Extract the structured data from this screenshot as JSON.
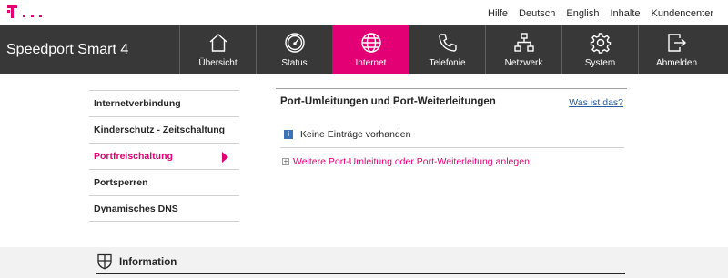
{
  "top_links": [
    "Hilfe",
    "Deutsch",
    "English",
    "Inhalte",
    "Kundencenter"
  ],
  "brand": "Speedport Smart 4",
  "nav": [
    {
      "label": "Übersicht",
      "icon": "home-icon",
      "active": false
    },
    {
      "label": "Status",
      "icon": "gauge-icon",
      "active": false
    },
    {
      "label": "Internet",
      "icon": "globe-icon",
      "active": true
    },
    {
      "label": "Telefonie",
      "icon": "phone-icon",
      "active": false
    },
    {
      "label": "Netzwerk",
      "icon": "network-icon",
      "active": false
    },
    {
      "label": "System",
      "icon": "gear-icon",
      "active": false
    },
    {
      "label": "Abmelden",
      "icon": "logout-icon",
      "active": false
    }
  ],
  "sidebar": [
    {
      "label": "Internetverbindung",
      "active": false
    },
    {
      "label": "Kinderschutz - Zeitschaltung",
      "active": false
    },
    {
      "label": "Portfreischaltung",
      "active": true
    },
    {
      "label": "Portsperren",
      "active": false
    },
    {
      "label": "Dynamisches DNS",
      "active": false
    }
  ],
  "panel": {
    "title": "Port-Umleitungen und Port-Weiterleitungen",
    "help_link": "Was ist das?",
    "info_message": "Keine Einträge vorhanden",
    "add_link": "Weitere Port-Umleitung oder Port-Weiterleitung anlegen"
  },
  "info_section": {
    "heading": "Information"
  },
  "colors": {
    "accent": "#e20074",
    "navbar": "#383838",
    "link": "#2a5d9f"
  }
}
